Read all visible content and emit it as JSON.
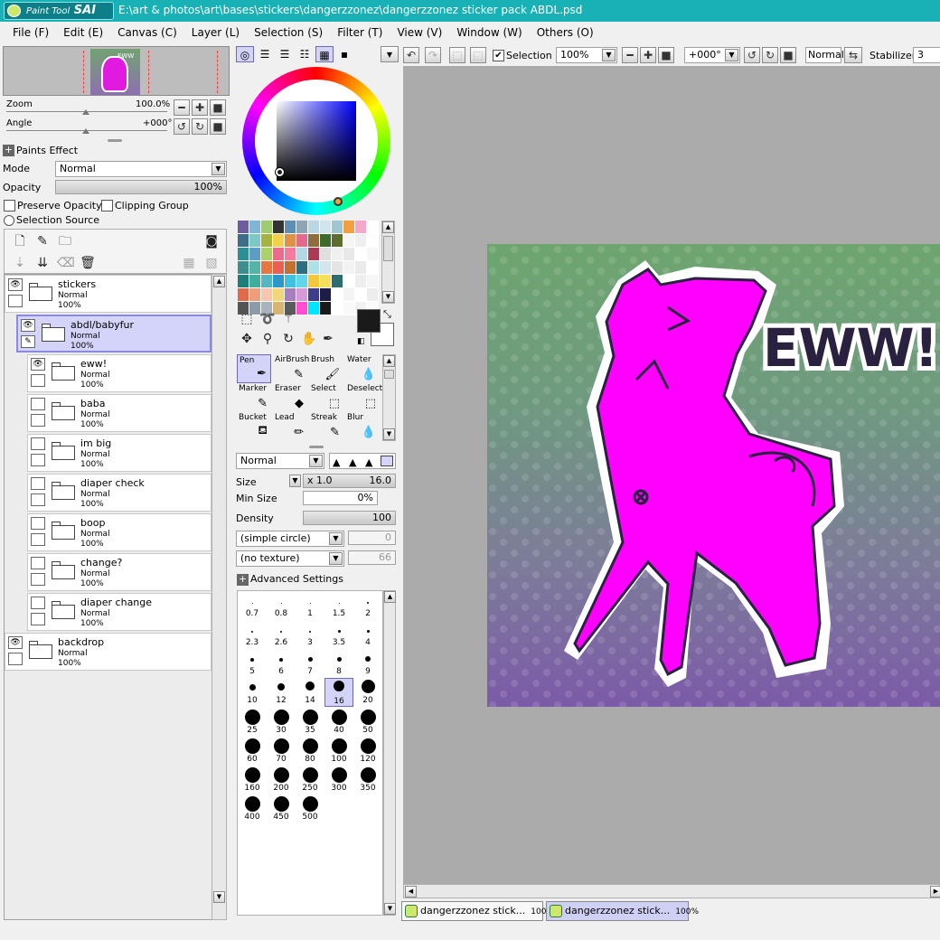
{
  "app": {
    "logo_small": "Paint Tool",
    "logo_big": "SAI",
    "file_path": "E:\\art & photos\\art\\bases\\stickers\\dangerzzonez\\dangerzzonez sticker pack ABDL.psd"
  },
  "menu": [
    "File (F)",
    "Edit (E)",
    "Canvas (C)",
    "Layer (L)",
    "Selection (S)",
    "Filter (T)",
    "View (V)",
    "Window (W)",
    "Others (O)"
  ],
  "navigator": {
    "thumb_text": "EWW",
    "zoom_label": "Zoom",
    "zoom_value": "100.0%",
    "angle_label": "Angle",
    "angle_value": "+000°"
  },
  "layer_props": {
    "paints_effect": "Paints Effect",
    "mode_label": "Mode",
    "mode_value": "Normal",
    "opacity_label": "Opacity",
    "opacity_value": "100%",
    "preserve_opacity": "Preserve Opacity",
    "clipping_group": "Clipping Group",
    "selection_source": "Selection Source"
  },
  "layers": [
    {
      "name": "stickers",
      "mode": "Normal",
      "opacity": "100%",
      "visible": true,
      "indent": 0,
      "selected": false
    },
    {
      "name": "abdl/babyfur",
      "mode": "Normal",
      "opacity": "100%",
      "visible": true,
      "indent": 1,
      "selected": true
    },
    {
      "name": "eww!",
      "mode": "Normal",
      "opacity": "100%",
      "visible": true,
      "indent": 2,
      "selected": false
    },
    {
      "name": "baba",
      "mode": "Normal",
      "opacity": "100%",
      "visible": false,
      "indent": 2,
      "selected": false
    },
    {
      "name": "im big",
      "mode": "Normal",
      "opacity": "100%",
      "visible": false,
      "indent": 2,
      "selected": false
    },
    {
      "name": "diaper check",
      "mode": "Normal",
      "opacity": "100%",
      "visible": false,
      "indent": 2,
      "selected": false
    },
    {
      "name": "boop",
      "mode": "Normal",
      "opacity": "100%",
      "visible": false,
      "indent": 2,
      "selected": false
    },
    {
      "name": "change?",
      "mode": "Normal",
      "opacity": "100%",
      "visible": false,
      "indent": 2,
      "selected": false
    },
    {
      "name": "diaper change",
      "mode": "Normal",
      "opacity": "100%",
      "visible": false,
      "indent": 2,
      "selected": false
    },
    {
      "name": "backdrop",
      "mode": "Normal",
      "opacity": "100%",
      "visible": true,
      "indent": 0,
      "selected": false
    }
  ],
  "swatches": [
    "#6d5d9e",
    "#7fb6d6",
    "#9ccc6d",
    "#333333",
    "#5e8fb2",
    "#8ea5b5",
    "#b9d7e4",
    "#cfe6ee",
    "#9fc7d3",
    "#f29f3f",
    "#f4a7c9",
    "#ffffff",
    "#3b6e88",
    "#7cc8c4",
    "#a6b33f",
    "#f4d04c",
    "#e09148",
    "#e46a8c",
    "#8f6d3f",
    "#3f6b2a",
    "#5d6d2f",
    "#f5f5f5",
    "#efefef",
    "#ffffff",
    "#2d8f93",
    "#5d9dc2",
    "#a9d36a",
    "#eb6b8f",
    "#f47b9e",
    "#b2d8e6",
    "#ab3a55",
    "#dfdfdf",
    "#f0f0f0",
    "#e8e8e8",
    "#ffffff",
    "#f7f7f7",
    "#3e8f8c",
    "#53b4a7",
    "#e6783f",
    "#e95f52",
    "#c46f36",
    "#2e6d82",
    "#aee0e8",
    "#d3e6ee",
    "#e5e5e5",
    "#f2f2f2",
    "#eaeaea",
    "#ffffff",
    "#1e7f7a",
    "#3fae9e",
    "#55b7c4",
    "#2d97c9",
    "#3ec2e0",
    "#63d5e8",
    "#f2c93a",
    "#f4e05a",
    "#2e6d6e",
    "#ffffff",
    "#eeeeee",
    "#f6f6f6",
    "#e06a4a",
    "#f09d7a",
    "#f6c6ae",
    "#f1d67a",
    "#a77fbf",
    "#d79ad8",
    "#3d3d8b",
    "#1d1d48",
    "#ffffff",
    "#f4f4f4",
    "#ffffff",
    "#ededed",
    "#545454",
    "#8b9ba8",
    "#a9b3bb",
    "#d9b473",
    "#5a5a5a",
    "#ff4fd1",
    "#00e5ff",
    "#1a1a1a",
    "#ffffff",
    "#f9f9f9",
    "#f1f1f1",
    "#fafafa"
  ],
  "tools": [
    {
      "label": "Pen",
      "icon": "pen-icon",
      "glyph": "✒",
      "selected": true
    },
    {
      "label": "AirBrush",
      "icon": "airbrush-icon",
      "glyph": "✎",
      "selected": false
    },
    {
      "label": "Brush",
      "icon": "brush-icon",
      "glyph": "🖌",
      "selected": false
    },
    {
      "label": "Water",
      "icon": "water-icon",
      "glyph": "💧",
      "selected": false
    },
    {
      "label": "Marker",
      "icon": "marker-icon",
      "glyph": "✎",
      "selected": false
    },
    {
      "label": "Eraser",
      "icon": "eraser-icon",
      "glyph": "◆",
      "selected": false
    },
    {
      "label": "Select",
      "icon": "select-icon",
      "glyph": "⬚",
      "selected": false
    },
    {
      "label": "Deselect",
      "icon": "deselect-icon",
      "glyph": "⬚",
      "selected": false
    },
    {
      "label": "Bucket",
      "icon": "bucket-icon",
      "glyph": "⛾",
      "selected": false
    },
    {
      "label": "Lead",
      "icon": "lead-icon",
      "glyph": "✏",
      "selected": false
    },
    {
      "label": "Streak",
      "icon": "streak-icon",
      "glyph": "✎",
      "selected": false
    },
    {
      "label": "Blur",
      "icon": "blur-icon",
      "glyph": "💧",
      "selected": false
    }
  ],
  "tool_settings": {
    "blend_mode": "Normal",
    "size_label": "Size",
    "size_mult": "x 1.0",
    "size_value": "16.0",
    "min_size_label": "Min Size",
    "min_size_value": "0%",
    "density_label": "Density",
    "density_value": "100",
    "shape": "(simple circle)",
    "shape_value": "0",
    "texture": "(no texture)",
    "texture_value": "66",
    "advanced": "Advanced Settings"
  },
  "brush_sizes": [
    {
      "label": "0.7",
      "dot": 1
    },
    {
      "label": "0.8",
      "dot": 1
    },
    {
      "label": "1",
      "dot": 1
    },
    {
      "label": "1.5",
      "dot": 1
    },
    {
      "label": "2",
      "dot": 2
    },
    {
      "label": "2.3",
      "dot": 2
    },
    {
      "label": "2.6",
      "dot": 2
    },
    {
      "label": "3",
      "dot": 2
    },
    {
      "label": "3.5",
      "dot": 3
    },
    {
      "label": "4",
      "dot": 3
    },
    {
      "label": "5",
      "dot": 4
    },
    {
      "label": "6",
      "dot": 4
    },
    {
      "label": "7",
      "dot": 5
    },
    {
      "label": "8",
      "dot": 5
    },
    {
      "label": "9",
      "dot": 6
    },
    {
      "label": "10",
      "dot": 7
    },
    {
      "label": "12",
      "dot": 8
    },
    {
      "label": "14",
      "dot": 10
    },
    {
      "label": "16",
      "dot": 12,
      "selected": true
    },
    {
      "label": "20",
      "dot": 15
    },
    {
      "label": "25",
      "dot": 17
    },
    {
      "label": "30",
      "dot": 17
    },
    {
      "label": "35",
      "dot": 17
    },
    {
      "label": "40",
      "dot": 17
    },
    {
      "label": "50",
      "dot": 17
    },
    {
      "label": "60",
      "dot": 17
    },
    {
      "label": "70",
      "dot": 17
    },
    {
      "label": "80",
      "dot": 17
    },
    {
      "label": "100",
      "dot": 17
    },
    {
      "label": "120",
      "dot": 17
    },
    {
      "label": "160",
      "dot": 17
    },
    {
      "label": "200",
      "dot": 17
    },
    {
      "label": "250",
      "dot": 17
    },
    {
      "label": "300",
      "dot": 17
    },
    {
      "label": "350",
      "dot": 17
    },
    {
      "label": "400",
      "dot": 17
    },
    {
      "label": "450",
      "dot": 17
    },
    {
      "label": "500",
      "dot": 17
    }
  ],
  "canvas_toolbar": {
    "selection_label": "Selection",
    "zoom": "100%",
    "angle": "+000°",
    "blend": "Normal",
    "stabilizer_label": "Stabilizer",
    "stabilizer_value": "3"
  },
  "artwork": {
    "speech_text": "EWW!",
    "colors": {
      "figure": "#ff00ff",
      "outline": "#2a2040",
      "bg_top": "#6ea56f",
      "bg_bottom": "#7b5aa8"
    }
  },
  "doc_tabs": [
    {
      "name": "dangerzzonez stick...",
      "zoom": "100%",
      "active": false
    },
    {
      "name": "dangerzzonez stick...",
      "zoom": "100%",
      "active": true
    }
  ]
}
